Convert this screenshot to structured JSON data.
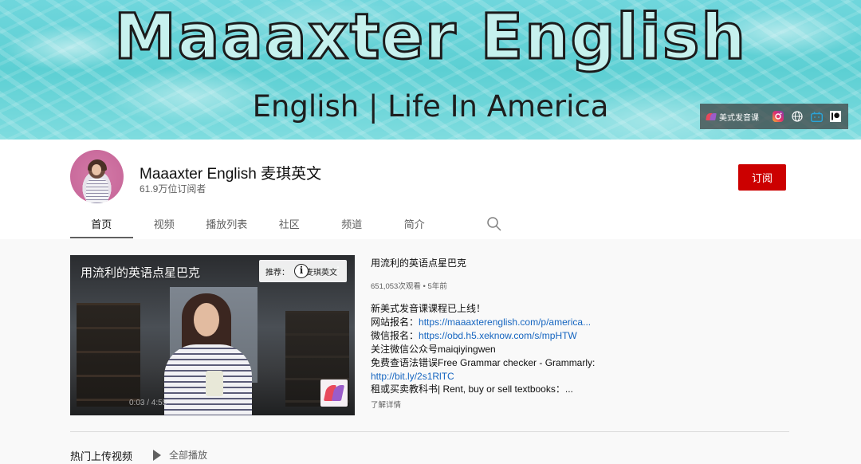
{
  "banner": {
    "title": "Maaaxter English",
    "subtitle": "English | Life In America",
    "links": {
      "main_label": "美式发音课",
      "icons": [
        "instagram-icon",
        "globe-icon",
        "bilibili-icon",
        "patreon-icon"
      ]
    }
  },
  "channel": {
    "name": "Maaaxter English 麦琪英文",
    "subscribers": "61.9万位订阅者",
    "subscribe_label": "订阅"
  },
  "tabs": [
    {
      "label": "首页",
      "active": true
    },
    {
      "label": "视频",
      "active": false
    },
    {
      "label": "播放列表",
      "active": false
    },
    {
      "label": "社区",
      "active": false
    },
    {
      "label": "频道",
      "active": false
    },
    {
      "label": "简介",
      "active": false
    }
  ],
  "featured": {
    "video_overlay_title": "用流利的英语点星巴克",
    "recommend_label": "推荐：",
    "recommend_channel": "麦琪英文",
    "time": "0:03 / 4:55",
    "title": "用流利的英语点星巴克",
    "meta": "651,053次观看 • 5年前",
    "description": [
      {
        "text": "新美式发音课课程已上线！"
      },
      {
        "text": "网站报名：",
        "link": "https://maaaxterenglish.com/p/america..."
      },
      {
        "text": "微信报名：",
        "link": "https://obd.h5.xeknow.com/s/mpHTW"
      },
      {
        "text": "关注微信公众号maiqiyingwen"
      },
      {
        "text": "免费查语法错误Free Grammar checker - Grammarly:"
      },
      {
        "text": "",
        "link": "http://bit.ly/2s1RlTC"
      },
      {
        "text": "租或买卖教科书| Rent, buy or sell textbooks：..."
      }
    ],
    "more_label": "了解详情"
  },
  "shelf": {
    "title": "热门上传视频",
    "play_all_label": "全部播放"
  },
  "colors": {
    "subscribe": "#cc0000",
    "link": "#1565c0",
    "banner_water": "#5ccfd3"
  }
}
